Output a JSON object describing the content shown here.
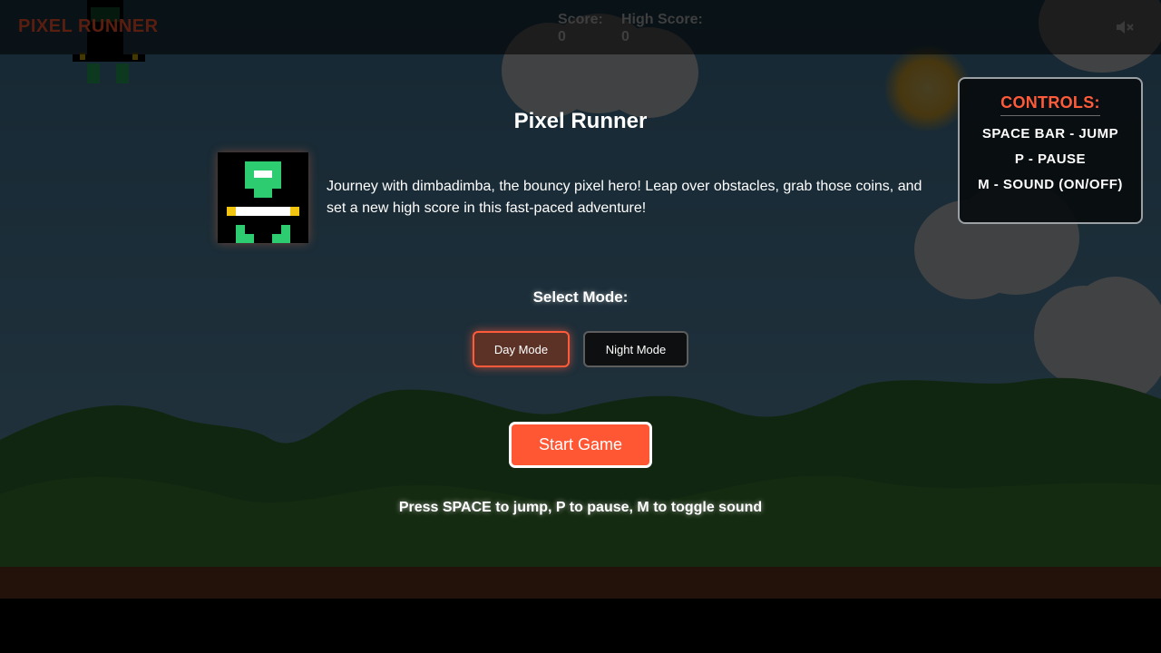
{
  "header": {
    "logo": "PIXEL RUNNER",
    "score_label": "Score:",
    "score_value": "0",
    "high_score_label": "High Score:",
    "high_score_value": "0",
    "sound_icon": "speaker-muted-icon"
  },
  "main": {
    "title": "Pixel Runner",
    "description": "Journey with dimbadimba, the bouncy pixel hero! Leap over obstacles, grab those coins, and set a new high score in this fast-paced adventure!",
    "mode_label": "Select Mode:",
    "modes": [
      {
        "label": "Day Mode",
        "selected": true
      },
      {
        "label": "Night Mode",
        "selected": false
      }
    ],
    "start_label": "Start Game",
    "hint": "Press SPACE to jump, P to pause, M to toggle sound"
  },
  "controls": {
    "title": "CONTROLS:",
    "items": [
      "SPACE BAR - JUMP",
      "P - PAUSE",
      "M - SOUND (ON/OFF)"
    ]
  },
  "colors": {
    "accent": "#ff5733",
    "hero_green": "#2ecc71",
    "hero_gold": "#f1c40f",
    "ground": "#7b4321"
  }
}
